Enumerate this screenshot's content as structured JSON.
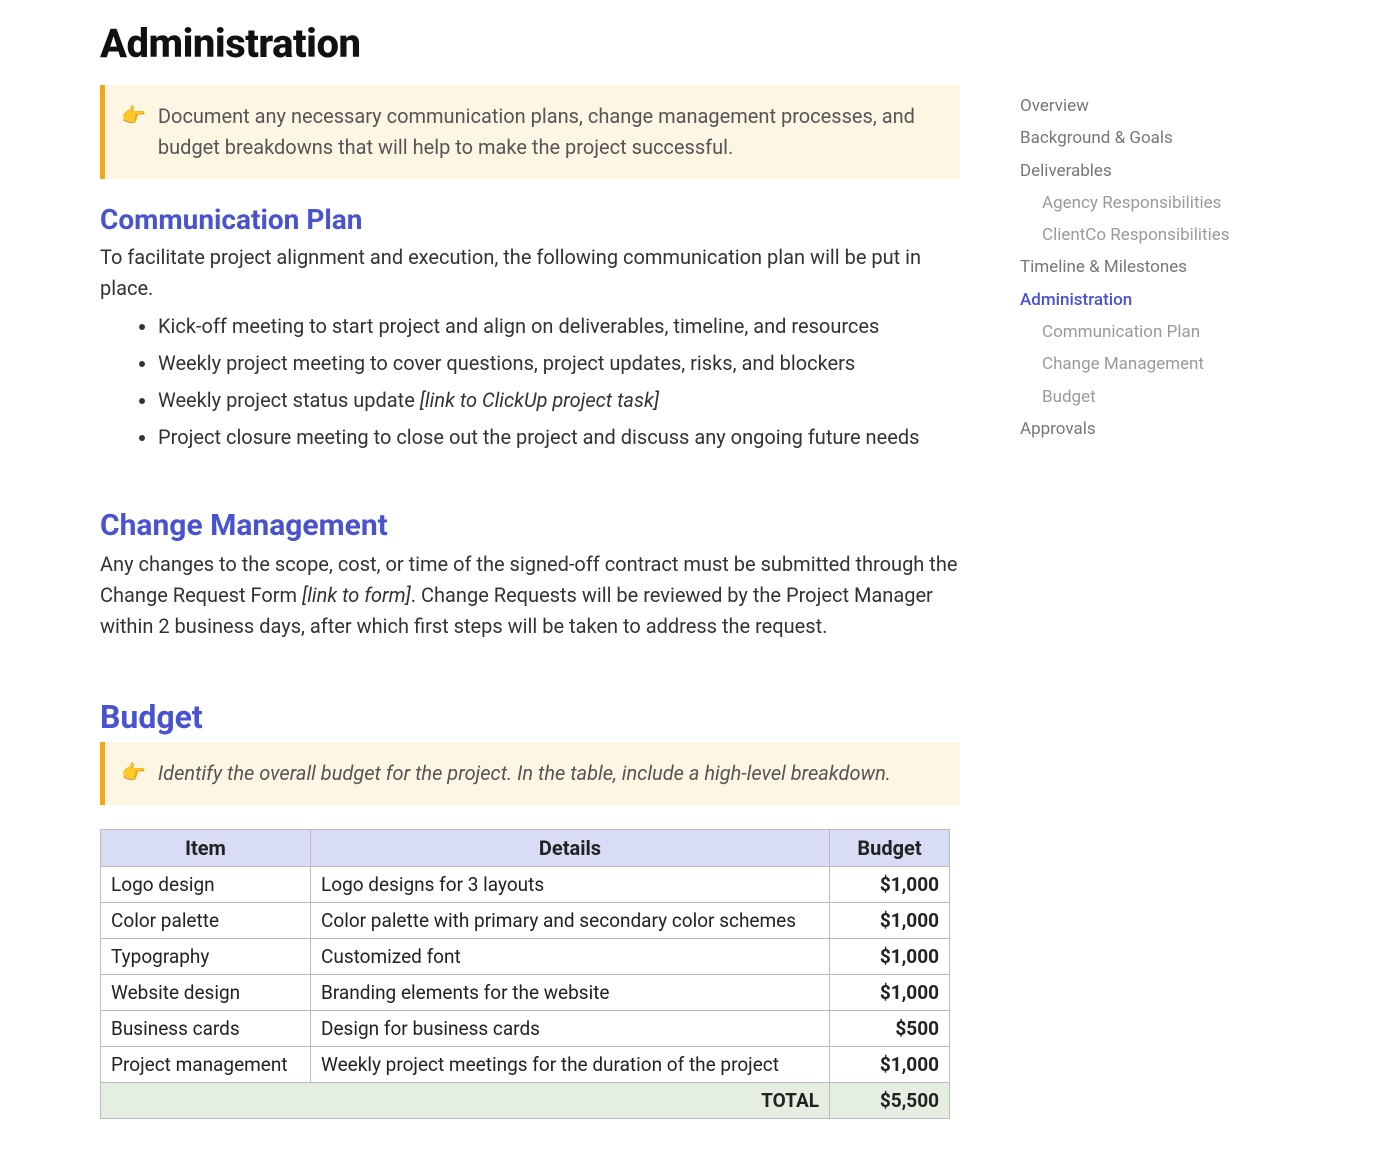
{
  "title": "Administration",
  "callout1": "Document any necessary communication plans, change management processes, and budget breakdowns that will help to make the project successful.",
  "pointer_emoji": "👉",
  "comm_plan": {
    "heading": "Communication Plan",
    "intro": "To facilitate project alignment and execution, the following communication plan will be put in place.",
    "items": [
      "Kick-off meeting to start project and align on deliverables, timeline, and resources",
      "Weekly project meeting to cover questions, project updates, risks, and blockers",
      "Weekly project status update ",
      "Project closure meeting to close out the project and discuss any ongoing future needs"
    ],
    "item2_link": "[link to ClickUp project task]"
  },
  "change_mgmt": {
    "heading": "Change Management",
    "text_a": "Any changes to the scope, cost, or time of the signed-off contract must be submitted through the Change Request Form ",
    "link": "[link to form]",
    "text_b": ". Change Requests will be reviewed by the Project Manager within 2 business days, after which first steps will be taken to address the request."
  },
  "budget": {
    "heading": "Budget",
    "callout": "Identify the overall budget for the project. In the table, include a high-level breakdown.",
    "cols": [
      "Item",
      "Details",
      "Budget"
    ],
    "rows": [
      {
        "item": "Logo design",
        "details": "Logo designs for 3 layouts",
        "amount": "$1,000"
      },
      {
        "item": "Color palette",
        "details": "Color palette with primary and secondary color schemes",
        "amount": "$1,000"
      },
      {
        "item": "Typography",
        "details": "Customized font",
        "amount": "$1,000"
      },
      {
        "item": "Website design",
        "details": "Branding elements for the website",
        "amount": "$1,000"
      },
      {
        "item": "Business cards",
        "details": "Design for business cards",
        "amount": "$500"
      },
      {
        "item": "Project management",
        "details": "Weekly project meetings for the duration of the project",
        "amount": "$1,000"
      }
    ],
    "total_label": "TOTAL",
    "total_amount": "$5,500"
  },
  "toc": [
    {
      "label": "Overview",
      "sub": false,
      "active": false
    },
    {
      "label": "Background & Goals",
      "sub": false,
      "active": false
    },
    {
      "label": "Deliverables",
      "sub": false,
      "active": false
    },
    {
      "label": "Agency Responsibilities",
      "sub": true,
      "active": false
    },
    {
      "label": "ClientCo Responsibilities",
      "sub": true,
      "active": false
    },
    {
      "label": "Timeline & Milestones",
      "sub": false,
      "active": false
    },
    {
      "label": "Administration",
      "sub": false,
      "active": true
    },
    {
      "label": "Communication Plan",
      "sub": true,
      "active": false
    },
    {
      "label": "Change Management",
      "sub": true,
      "active": false
    },
    {
      "label": "Budget",
      "sub": true,
      "active": false
    },
    {
      "label": "Approvals",
      "sub": false,
      "active": false
    }
  ]
}
